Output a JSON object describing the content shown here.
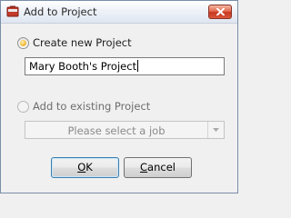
{
  "window": {
    "title": "Add to Project",
    "icons": {
      "app": "project-folder-icon",
      "close": "close-icon"
    }
  },
  "options": {
    "create_new": {
      "label": "Create new Project",
      "checked": true
    },
    "project_name": {
      "value": "Mary Booth's Project"
    },
    "add_existing": {
      "label": "Add to existing Project",
      "checked": false,
      "enabled": false
    },
    "job_select": {
      "placeholder": "Please select a job",
      "enabled": false
    }
  },
  "buttons": {
    "ok": {
      "mnemonic": "O",
      "rest": "K"
    },
    "cancel": {
      "mnemonic": "C",
      "rest": "ancel"
    }
  },
  "colors": {
    "window_bg": "#f0f0f0",
    "close_button": "#c8381f",
    "radio_selected": "#f7c548",
    "disabled_text": "#8a8a8a"
  }
}
